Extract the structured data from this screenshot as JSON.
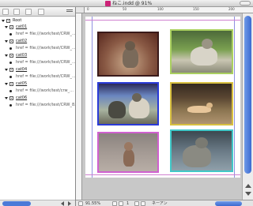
{
  "window": {
    "title": "ねこ.indd @ 91%"
  },
  "structure": {
    "root_label": "Root",
    "items": [
      {
        "tag": "cat01",
        "href": "href = file:///work/test/CRW_..."
      },
      {
        "tag": "cat02",
        "href": "href = file:///work/test/CRW_..."
      },
      {
        "tag": "cat03",
        "href": "href = file:///work/test/CRW_..."
      },
      {
        "tag": "cat04",
        "href": "href = file:///work/test/CRW_..."
      },
      {
        "tag": "cat05",
        "href": "href = file:///work/test/crw_..."
      },
      {
        "tag": "cat06",
        "href": "href = file:///work/test/CRW_8..."
      }
    ]
  },
  "ruler": {
    "top_labels": [
      "0",
      "50",
      "100",
      "150",
      "200"
    ]
  },
  "status": {
    "zoom": "91.55%",
    "page_number": "1",
    "mode": "ネーアン"
  },
  "colors": {
    "frame1": "#3a1a1a",
    "frame2": "#aad060",
    "frame3": "#2a3ad8",
    "frame4": "#d8c040",
    "frame5": "#d060d0",
    "frame6": "#40c8c8",
    "scroll_accent": "#3c6ad0"
  }
}
